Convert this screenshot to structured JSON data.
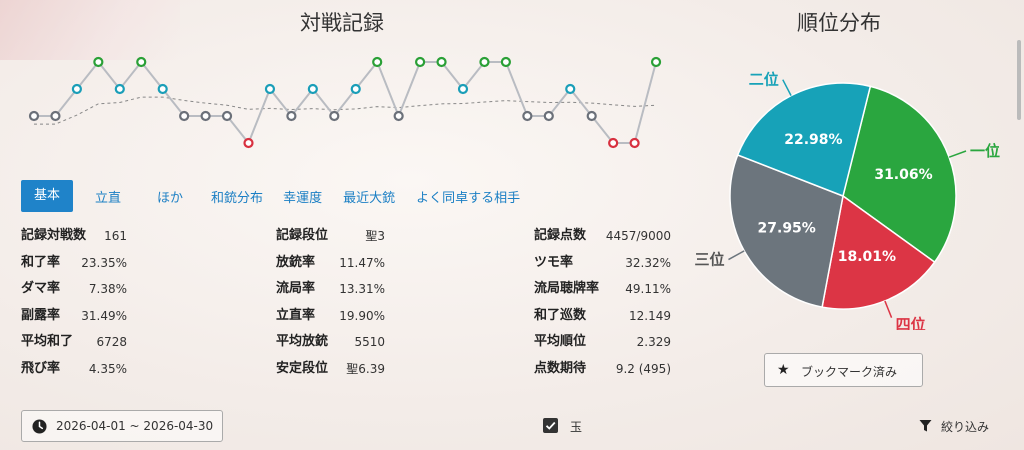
{
  "titles": {
    "left": "対戦記録",
    "right": "順位分布"
  },
  "tabs": [
    "基本",
    "立直",
    "ほか",
    "和銃分布",
    "幸運度",
    "最近大銃",
    "よく同卓する相手"
  ],
  "stats": {
    "col1": [
      {
        "label": "記録対戦数",
        "value": "161"
      },
      {
        "label": "和了率",
        "value": "23.35%"
      },
      {
        "label": "ダマ率",
        "value": "7.38%"
      },
      {
        "label": "副露率",
        "value": "31.49%"
      },
      {
        "label": "平均和了",
        "value": "6728"
      },
      {
        "label": "飛び率",
        "value": "4.35%"
      }
    ],
    "col2": [
      {
        "label": "記録段位",
        "value": "聖3"
      },
      {
        "label": "放銃率",
        "value": "11.47%"
      },
      {
        "label": "流局率",
        "value": "13.31%"
      },
      {
        "label": "立直率",
        "value": "19.90%"
      },
      {
        "label": "平均放銃",
        "value": "5510"
      },
      {
        "label": "安定段位",
        "value": "聖6.39"
      }
    ],
    "col3": [
      {
        "label": "記録点数",
        "value": "4457/9000"
      },
      {
        "label": "ツモ率",
        "value": "32.32%"
      },
      {
        "label": "流局聴牌率",
        "value": "49.11%"
      },
      {
        "label": "和了巡数",
        "value": "12.149"
      },
      {
        "label": "平均順位",
        "value": "2.329"
      },
      {
        "label": "点数期待",
        "value": "9.2 (495)"
      }
    ]
  },
  "date_range": "2026-04-01 ~ 2026-04-30",
  "tama_label": "玉",
  "bookmark_label": "ブックマーク済み",
  "filter_label": "絞り込み",
  "recent_ranks": [
    3,
    3,
    2,
    1,
    2,
    1,
    2,
    3,
    3,
    3,
    4,
    2,
    3,
    2,
    3,
    2,
    1,
    3,
    1,
    1,
    2,
    1,
    1,
    3,
    3,
    2,
    3,
    4,
    4,
    1
  ],
  "rank_colors": {
    "1": "#2aa036",
    "2": "#1a9eb8",
    "3": "#6b7079",
    "4": "#d8303f"
  },
  "chart_data": {
    "type": "pie",
    "title": "順位分布",
    "slices": [
      {
        "label": "一位",
        "value": 31.06,
        "display": "31.06%",
        "color": "#2aa63f"
      },
      {
        "label": "四位",
        "value": 18.01,
        "display": "18.01%",
        "color": "#dc3545"
      },
      {
        "label": "三位",
        "value": 27.95,
        "display": "27.95%",
        "color": "#6c757d"
      },
      {
        "label": "二位",
        "value": 22.98,
        "display": "22.98%",
        "color": "#17a2b8"
      }
    ]
  }
}
